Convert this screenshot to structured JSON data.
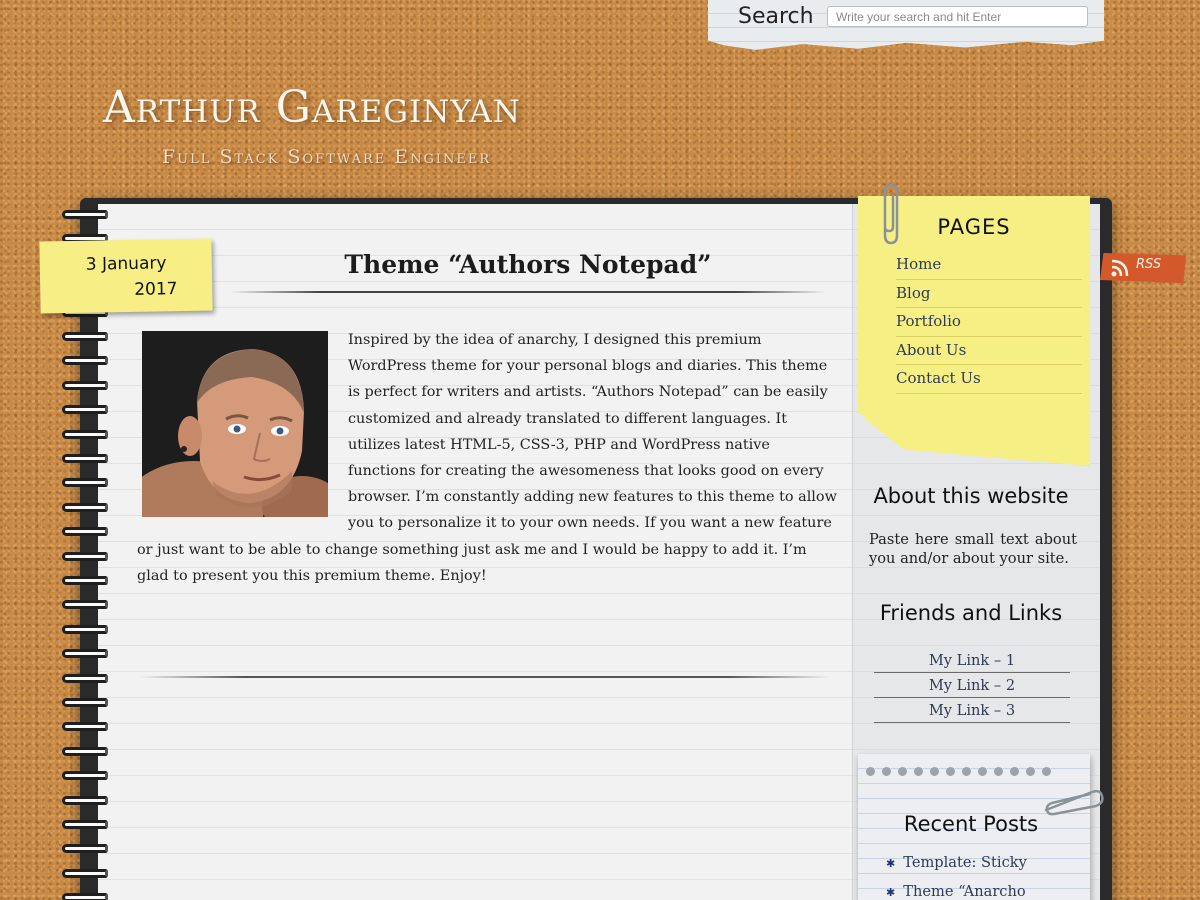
{
  "search": {
    "label": "Search",
    "placeholder": "Write your search and hit Enter"
  },
  "header": {
    "title": "Arthur Gareginyan",
    "tagline": "Full Stack Software Engineer"
  },
  "post": {
    "date_day": "3 January",
    "date_year": "2017",
    "title": "Theme “Authors Notepad”",
    "body": "Inspired by the idea of anarchy, I designed this premium WordPress theme for your personal blogs and diaries. This theme is perfect for writers and artists. “Authors Notepad” can be easily customized and already translated to different languages. It utilizes latest HTML-5, CSS-3, PHP and WordPress native functions for creating the awesomeness that looks good on every browser. I’m constantly adding new features to this theme to allow you to personalize it to your own needs. If you want a new feature or just want to be able to change something just ask me and I would be happy to add it. I’m glad to present you this premium theme. Enjoy!"
  },
  "pages_widget": {
    "title": "PAGES",
    "items": [
      {
        "label": "Home"
      },
      {
        "label": "Blog"
      },
      {
        "label": "Portfolio"
      },
      {
        "label": "About Us"
      },
      {
        "label": "Contact Us"
      }
    ]
  },
  "rss": {
    "label": "RSS"
  },
  "about_widget": {
    "title": "About this website",
    "text": "Paste here small text about you and/or about your site."
  },
  "links_widget": {
    "title": "Friends and Links",
    "items": [
      {
        "label": "My Link – 1"
      },
      {
        "label": "My Link – 2"
      },
      {
        "label": "My Link – 3"
      }
    ]
  },
  "recent_widget": {
    "title": "Recent Posts",
    "items": [
      {
        "label": "Template: Sticky"
      },
      {
        "label": "Theme “Anarcho"
      }
    ]
  },
  "colors": {
    "cork": "#c98a46",
    "sticky_note": "#f6ef84",
    "rss_tag": "#d4592a",
    "link": "#2f3b55"
  },
  "icons": [
    "paperclip-icon",
    "rss-icon",
    "bullet-icon"
  ]
}
